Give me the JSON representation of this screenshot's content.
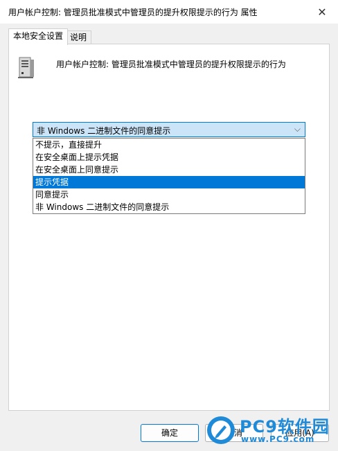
{
  "window": {
    "title": "用户帐户控制: 管理员批准模式中管理员的提升权限提示的行为 属性",
    "close_glyph": "✕"
  },
  "tabs": [
    {
      "label": "本地安全设置",
      "active": true
    },
    {
      "label": "说明",
      "active": false
    }
  ],
  "policy": {
    "title": "用户帐户控制: 管理员批准模式中管理员的提升权限提示的行为",
    "icon": "server-computer-icon"
  },
  "select": {
    "value": "非 Windows 二进制文件的同意提示",
    "arrow_glyph": "⌵"
  },
  "dropdown": {
    "options": [
      "不提示，直接提升",
      "在安全桌面上提示凭据",
      "在安全桌面上同意提示",
      "提示凭据",
      "同意提示",
      "非 Windows 二进制文件的同意提示"
    ],
    "selected_index": 3
  },
  "buttons": {
    "ok": "确定",
    "cancel": "取消",
    "apply": "应用(A)"
  },
  "watermark": {
    "brand": "PC9软件园",
    "url": "www.PC9.com"
  },
  "colors": {
    "accent": "#0078d7",
    "select_bg": "#cce4f7",
    "watermark": "#1f8ad8"
  }
}
